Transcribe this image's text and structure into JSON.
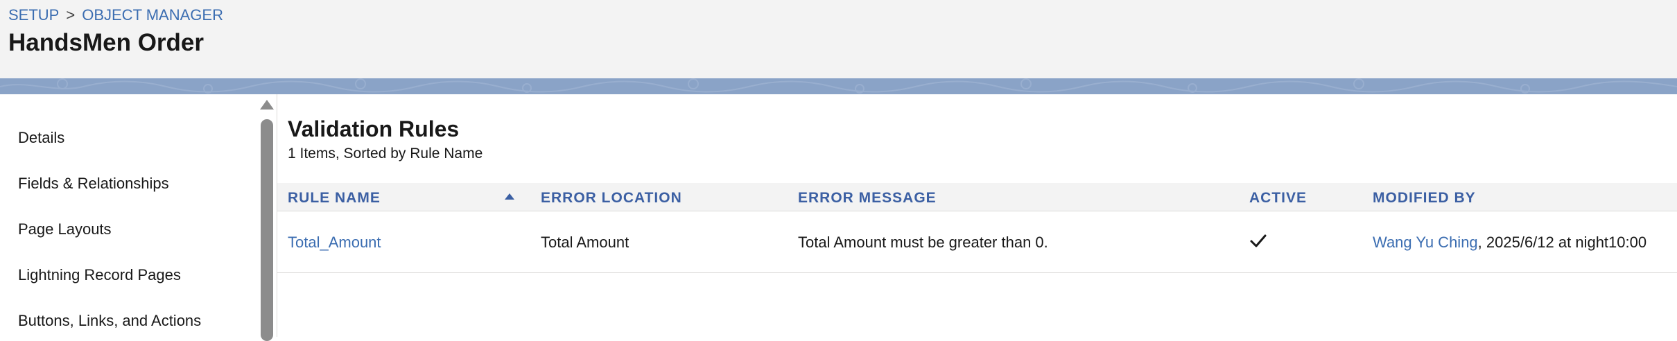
{
  "header": {
    "breadcrumb": [
      "SETUP",
      ">",
      "OBJECT MANAGER"
    ],
    "title": "HandsMen Order"
  },
  "sidebar": {
    "items": [
      {
        "label": "Details"
      },
      {
        "label": "Fields & Relationships"
      },
      {
        "label": "Page Layouts"
      },
      {
        "label": "Lightning Record Pages"
      },
      {
        "label": "Buttons, Links, and Actions"
      }
    ]
  },
  "main": {
    "title": "Validation Rules",
    "subtitle": "1 Items, Sorted by Rule Name",
    "columns": [
      "RULE NAME",
      "ERROR LOCATION",
      "ERROR MESSAGE",
      "ACTIVE",
      "MODIFIED BY"
    ],
    "sort": {
      "column": "RULE NAME",
      "direction": "ascending",
      "icon": "sort-ascending-icon"
    },
    "rows": [
      {
        "rule_name": "Total_Amount",
        "error_location": "Total Amount",
        "error_message": "Total Amount must be greater than 0.",
        "active": true,
        "active_icon": "checkmark-icon",
        "modified_by_name": "Wang Yu Ching",
        "modified_by_suffix": ", 2025/6/12 at night10:00"
      }
    ]
  },
  "colors": {
    "link": "#3b6db1",
    "header_text": "#3b5fa3",
    "band": "#8aa3c7",
    "header_bg": "#f3f3f3"
  }
}
